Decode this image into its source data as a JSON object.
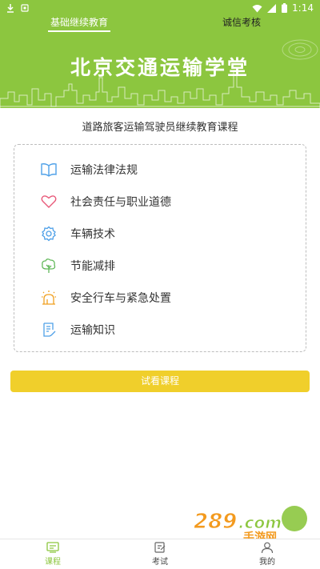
{
  "statusbar": {
    "time": "1:14"
  },
  "topnav": {
    "tabs": [
      {
        "label": "基础继续教育"
      },
      {
        "label": "诚信考核"
      }
    ]
  },
  "banner": {
    "title": "北京交通运输学堂"
  },
  "course": {
    "subtitle": "道路旅客运输驾驶员继续教育课程"
  },
  "modules": [
    {
      "label": "运输法律法规",
      "icon": "book-icon",
      "color": "#4ea0e8"
    },
    {
      "label": "社会责任与职业道德",
      "icon": "heart-icon",
      "color": "#e85a7a"
    },
    {
      "label": "车辆技术",
      "icon": "gear-icon",
      "color": "#4ea0e8"
    },
    {
      "label": "节能减排",
      "icon": "tree-icon",
      "color": "#62b85a"
    },
    {
      "label": "安全行车与紧急处置",
      "icon": "alarm-icon",
      "color": "#f0a020"
    },
    {
      "label": "运输知识",
      "icon": "document-icon",
      "color": "#4ea0e8"
    }
  ],
  "trial_button": {
    "label": "试看课程"
  },
  "watermark": {
    "text": "289.com 手游网"
  },
  "bottom_nav": {
    "items": [
      {
        "label": "课程",
        "icon": "course-icon"
      },
      {
        "label": "考试",
        "icon": "exam-icon"
      },
      {
        "label": "我的",
        "icon": "profile-icon"
      }
    ]
  },
  "colors": {
    "brand": "#8cc63f",
    "button": "#f0cf2b"
  }
}
